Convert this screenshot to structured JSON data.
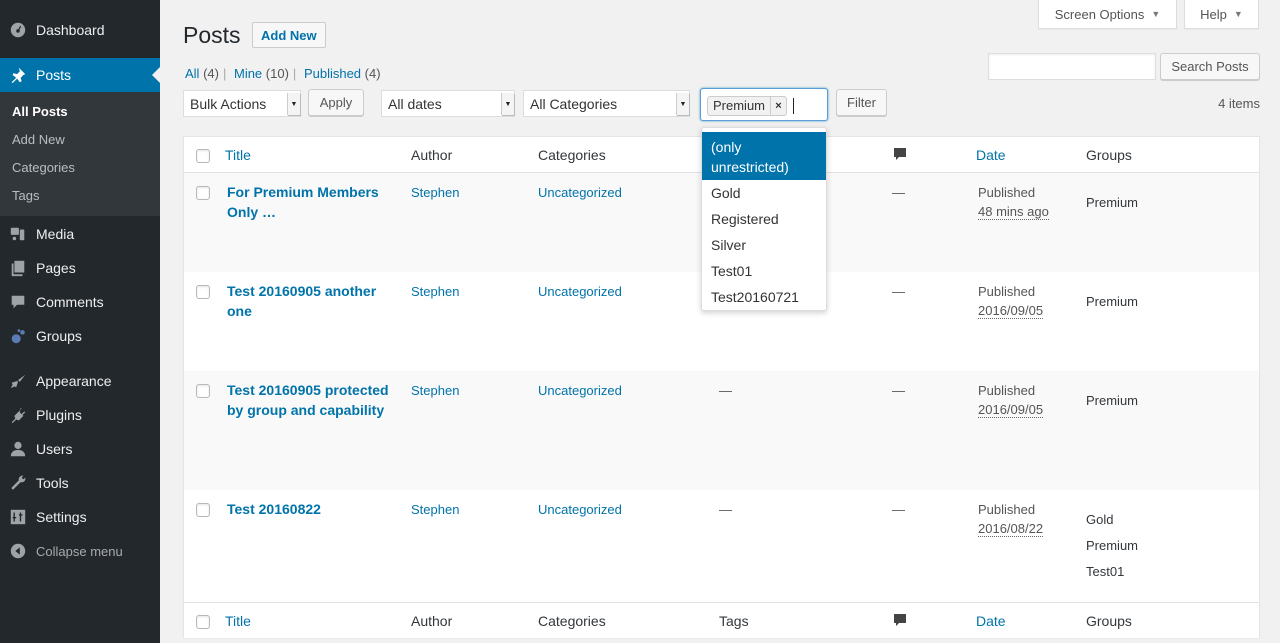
{
  "sidebar": {
    "items": [
      {
        "label": "Dashboard",
        "icon": "dashboard-icon"
      },
      {
        "label": "Posts",
        "icon": "pin-icon",
        "current": true
      },
      {
        "label": "Media",
        "icon": "media-icon"
      },
      {
        "label": "Pages",
        "icon": "pages-icon"
      },
      {
        "label": "Comments",
        "icon": "comments-icon"
      },
      {
        "label": "Groups",
        "icon": "groups-icon"
      },
      {
        "label": "Appearance",
        "icon": "brush-icon"
      },
      {
        "label": "Plugins",
        "icon": "plug-icon"
      },
      {
        "label": "Users",
        "icon": "user-icon"
      },
      {
        "label": "Tools",
        "icon": "wrench-icon"
      },
      {
        "label": "Settings",
        "icon": "settings-icon"
      }
    ],
    "submenu": [
      "All Posts",
      "Add New",
      "Categories",
      "Tags"
    ],
    "collapse_label": "Collapse menu"
  },
  "header": {
    "screen_options": "Screen Options",
    "help": "Help",
    "title": "Posts",
    "add_new": "Add New"
  },
  "views": [
    {
      "label": "All",
      "count": "(4)"
    },
    {
      "label": "Mine",
      "count": "(10)"
    },
    {
      "label": "Published",
      "count": "(4)"
    }
  ],
  "search": {
    "value": "",
    "button": "Search Posts"
  },
  "filters": {
    "bulk_actions": "Bulk Actions",
    "apply": "Apply",
    "dates": "All dates",
    "categories": "All Categories",
    "group_chip": "Premium",
    "chip_remove": "×",
    "filter": "Filter",
    "group_options": [
      "(only unrestricted)",
      "Gold",
      "Registered",
      "Silver",
      "Test01",
      "Test20160721"
    ]
  },
  "items_count": "4 items",
  "table": {
    "columns": {
      "title": "Title",
      "author": "Author",
      "categories": "Categories",
      "tags": "Tags",
      "date": "Date",
      "groups": "Groups"
    },
    "rows": [
      {
        "title": "For Premium Members Only …",
        "author": "Stephen",
        "category": "Uncategorized",
        "tags": "—",
        "comments": "—",
        "status": "Published",
        "date": "48 mins ago",
        "groups": [
          "Premium"
        ]
      },
      {
        "title": "Test 20160905 another one",
        "author": "Stephen",
        "category": "Uncategorized",
        "tags": "—",
        "comments": "—",
        "status": "Published",
        "date": "2016/09/05",
        "groups": [
          "Premium"
        ]
      },
      {
        "title": "Test 20160905 protected by group and capability",
        "author": "Stephen",
        "category": "Uncategorized",
        "tags": "—",
        "comments": "—",
        "status": "Published",
        "date": "2016/09/05",
        "groups": [
          "Premium"
        ]
      },
      {
        "title": "Test 20160822",
        "author": "Stephen",
        "category": "Uncategorized",
        "tags": "—",
        "comments": "—",
        "status": "Published",
        "date": "2016/08/22",
        "groups": [
          "Gold",
          "Premium",
          "Test01"
        ]
      }
    ]
  }
}
